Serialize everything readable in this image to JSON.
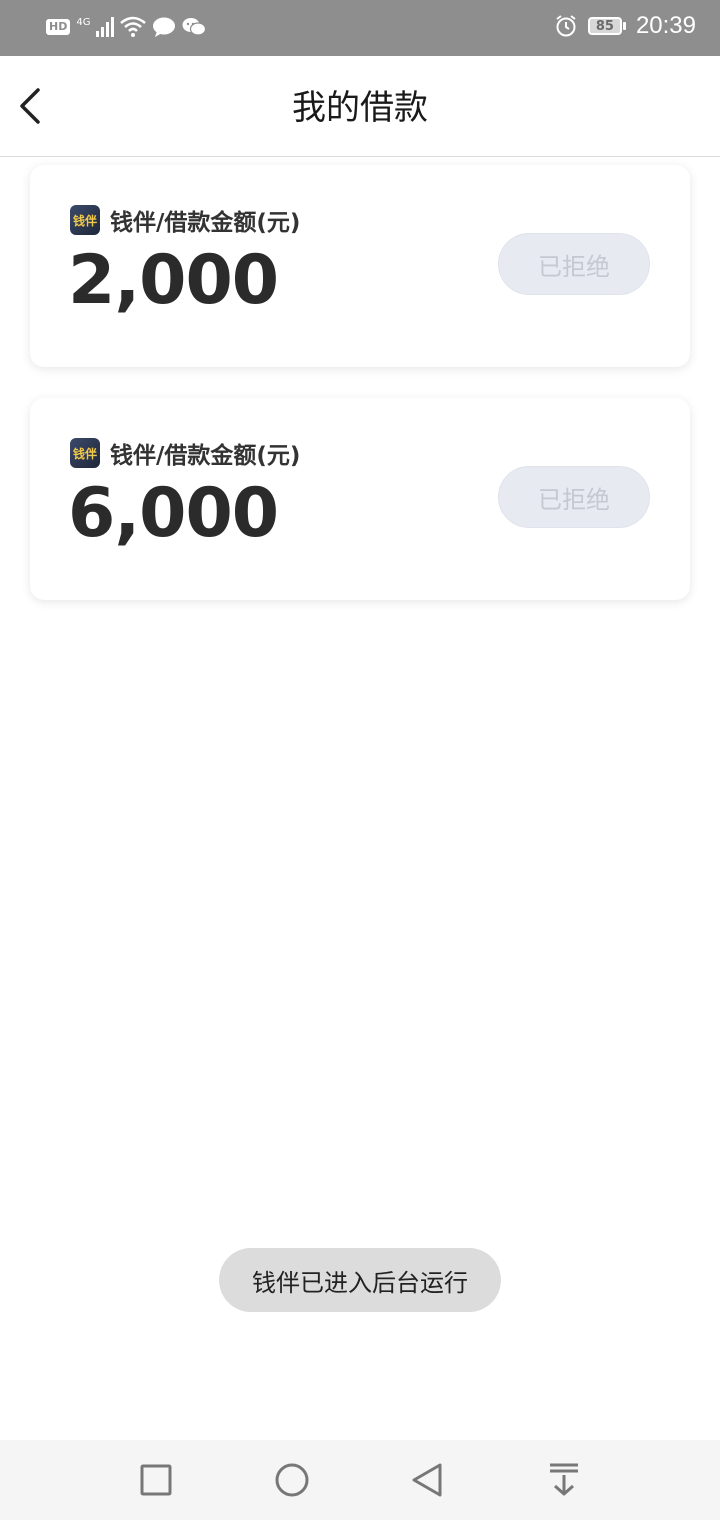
{
  "status_bar": {
    "hd": "HD",
    "network": "4G",
    "battery": "85",
    "time": "20:39",
    "icons": [
      "signal-icon",
      "wifi-icon",
      "chat-bubble-icon",
      "wechat-icon",
      "alarm-icon"
    ]
  },
  "header": {
    "title": "我的借款",
    "back_icon": "chevron-left-icon"
  },
  "loans": [
    {
      "logo_text": "钱伴",
      "label": "钱伴/借款金额(元)",
      "amount": "2,000",
      "status": "已拒绝"
    },
    {
      "logo_text": "钱伴",
      "label": "钱伴/借款金额(元)",
      "amount": "6,000",
      "status": "已拒绝"
    }
  ],
  "toast": "钱伴已进入后台运行",
  "nav_bar": {
    "icons": [
      "square-icon",
      "circle-icon",
      "triangle-back-icon",
      "download-arrow-icon"
    ]
  },
  "colors": {
    "status_bar_bg": "#8e8e8e",
    "pill_bg": "#e7eaf1",
    "pill_text": "#c4c8d1",
    "amount_text": "#2b2b2b"
  }
}
